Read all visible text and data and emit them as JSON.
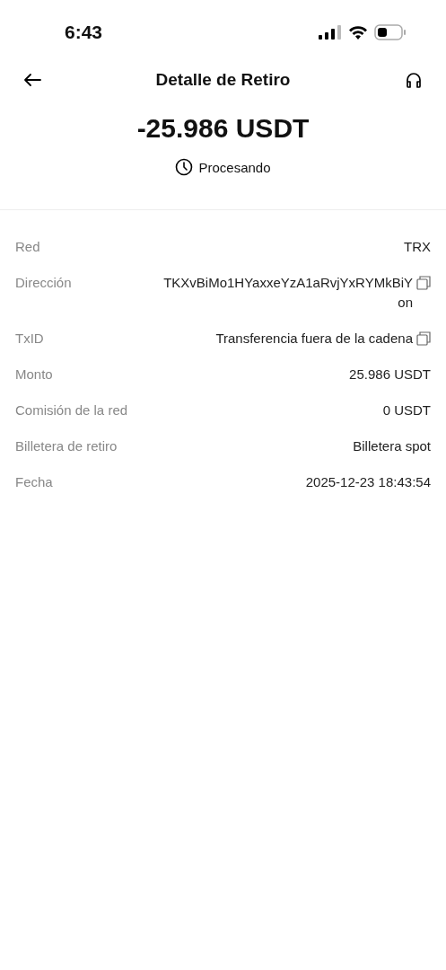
{
  "status_bar": {
    "time": "6:43"
  },
  "header": {
    "title": "Detalle de Retiro"
  },
  "summary": {
    "amount": "-25.986 USDT",
    "status": "Procesando"
  },
  "details": [
    {
      "label": "Red",
      "value": "TRX",
      "copyable": false
    },
    {
      "label": "Dirección",
      "value": "TKXvBiMo1HYaxxeYzA1aRvjYxRYMkBiYon",
      "copyable": true
    },
    {
      "label": "TxID",
      "value": "Transferencia fuera de la cadena",
      "copyable": true
    },
    {
      "label": "Monto",
      "value": "25.986 USDT",
      "copyable": false
    },
    {
      "label": "Comisión de la red",
      "value": "0 USDT",
      "copyable": false
    },
    {
      "label": "Billetera de retiro",
      "value": "Billetera spot",
      "copyable": false
    },
    {
      "label": "Fecha",
      "value": "2025-12-23 18:43:54",
      "copyable": false
    }
  ]
}
